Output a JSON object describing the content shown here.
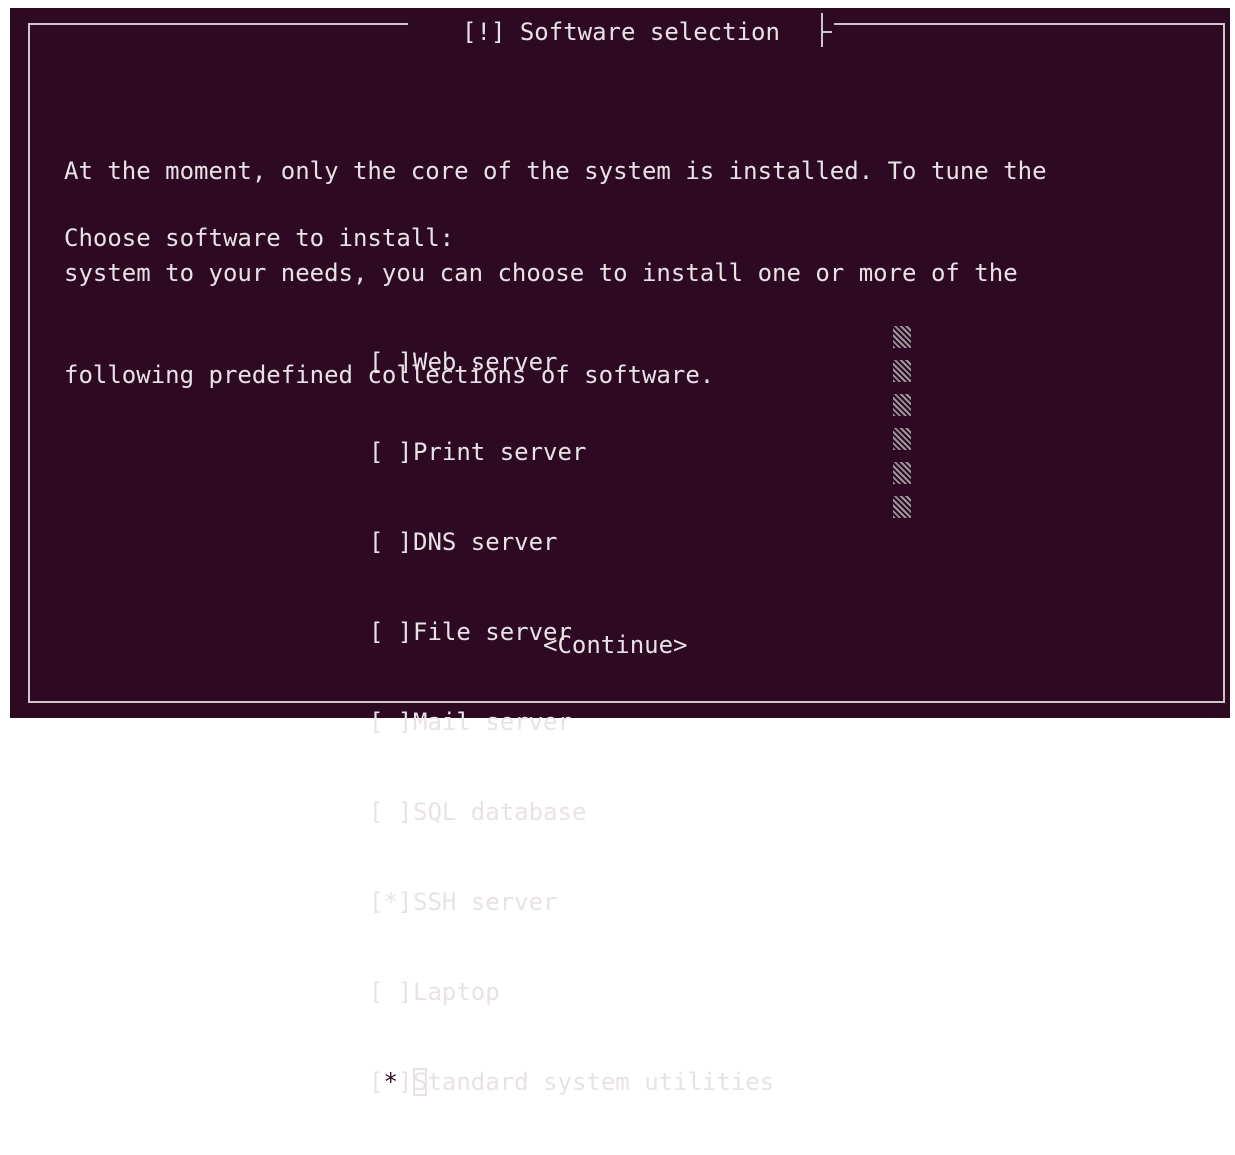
{
  "dialog": {
    "title": "[!] Software selection",
    "intro_lines": [
      "At the moment, only the core of the system is installed. To tune the",
      "system to your needs, you can choose to install one or more of the",
      "following predefined collections of software."
    ],
    "prompt": "Choose software to install:",
    "options": [
      {
        "checkbox": "[ ]",
        "label": "Web server",
        "checked": false
      },
      {
        "checkbox": "[ ]",
        "label": "Print server",
        "checked": false
      },
      {
        "checkbox": "[ ]",
        "label": "DNS server",
        "checked": false
      },
      {
        "checkbox": "[ ]",
        "label": "File server",
        "checked": false
      },
      {
        "checkbox": "[ ]",
        "label": "Mail server",
        "checked": false
      },
      {
        "checkbox": "[ ]",
        "label": "SQL database",
        "checked": false
      },
      {
        "checkbox": "[*]",
        "label": "SSH server",
        "checked": true
      },
      {
        "checkbox": "[ ]",
        "label": "Laptop",
        "checked": false
      },
      {
        "checkbox_open": "[",
        "checkbox_mark": "*",
        "checkbox_close": "]",
        "label_first": "S",
        "label_rest": "tandard system utilities",
        "checked": true
      }
    ],
    "continue_label": "<Continue>"
  },
  "colors": {
    "background": "#2d0a22",
    "text": "#e8e2e6",
    "border": "#cfc6cb"
  }
}
